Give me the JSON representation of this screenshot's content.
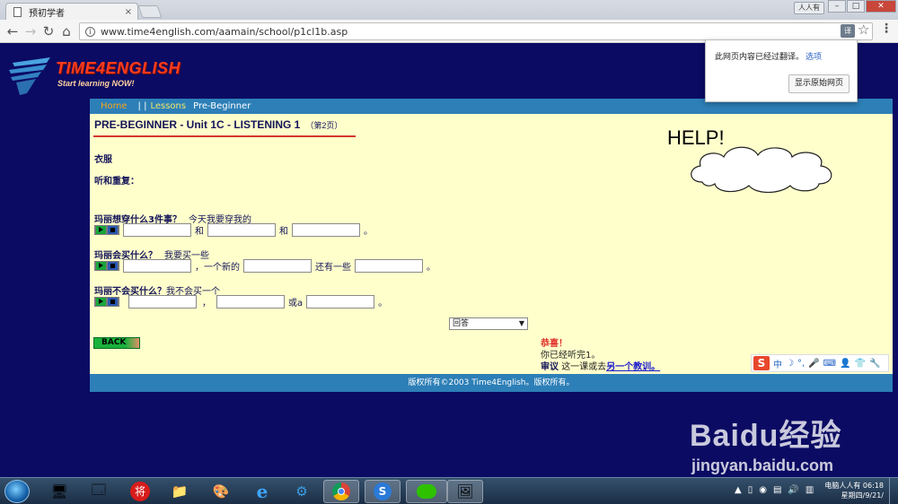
{
  "browser": {
    "tab_title": "预初学者",
    "tab_close": "×",
    "user_badge": "人人有",
    "url": "www.time4english.com/aamain/school/p1cl1b.asp",
    "translate_label": "译"
  },
  "translate_popup": {
    "message": "此网页内容已经过翻译。",
    "options": "选项",
    "show_original": "显示原始网页"
  },
  "site": {
    "logo_title": "TIME4ENGLISH",
    "logo_tagline": "Start learning NOW!",
    "nav": {
      "home": "Home",
      "sep": "| |",
      "lessons": "Lessons",
      "current": "Pre-Beginner"
    },
    "footer": "版权所有©2003 Time4English。版权所有。"
  },
  "lesson": {
    "title": "PRE-BEGINNER - Unit 1C - LISTENING 1",
    "page_label": "（第2页）",
    "topic": "衣服",
    "instruction": "听和重复：",
    "questions": [
      {
        "question": "玛丽想穿什么3件事？",
        "hint": "今天我要穿我的",
        "words": [
          "和",
          "和",
          "。"
        ]
      },
      {
        "question": "玛丽会买什么？",
        "hint": "我要买一些",
        "words": [
          "，一个新的",
          "还有一些",
          "。"
        ]
      },
      {
        "question": "玛丽不会买什么？",
        "hint": "我不会买一个",
        "words": [
          "，",
          "或a",
          "。"
        ]
      }
    ],
    "answer_select": "回答",
    "back_button": "BACK",
    "help": "HELP!",
    "congrats": {
      "line1": "恭喜！",
      "line2": "你已经听完1。",
      "line3_bold": "审议",
      "line3_text": "这一课或去",
      "line3_link": "另一个教训。"
    }
  },
  "ime_toolbar": [
    "中",
    "☽",
    "°,",
    "🎤",
    "⌨",
    "👤",
    "👕",
    "🔧"
  ],
  "watermark": {
    "brand": "Baidu经验",
    "domain": "jingyan.baidu.com"
  },
  "taskbar": {
    "clock_line1": "电脑人人有 06:18",
    "clock_line2": "星期四/9/21/"
  },
  "colors": {
    "page_bg": "#0b0b63",
    "content_bg": "#ffffcc",
    "nav_bg": "#2d7fb7",
    "accent_red": "#d23a2b"
  }
}
